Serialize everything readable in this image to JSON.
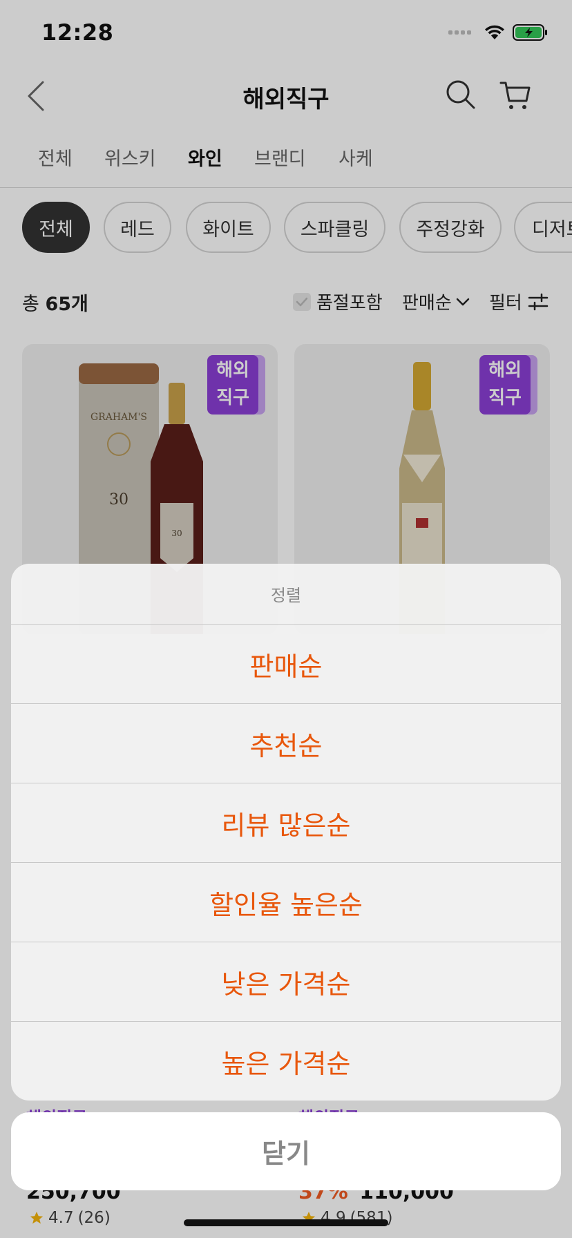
{
  "status_bar": {
    "time": "12:28"
  },
  "header": {
    "title": "해외직구"
  },
  "category_tabs": [
    "전체",
    "위스키",
    "와인",
    "브랜디",
    "사케"
  ],
  "chips": [
    "전체",
    "레드",
    "화이트",
    "스파클링",
    "주정강화",
    "디저트"
  ],
  "count": {
    "prefix": "총",
    "value": "65개"
  },
  "toolbar": {
    "soldout_label": "품절포함",
    "sort_label": "판매순",
    "filter_label": "필터"
  },
  "products": [
    {
      "badge_line1": "해외",
      "badge_line2": "직구",
      "brand": "해외직구",
      "price": "250,700",
      "discount": "",
      "rating": "4.7",
      "reviews": "(26)"
    },
    {
      "badge_line1": "해외",
      "badge_line2": "직구",
      "brand": "해외직구",
      "price": "110,000",
      "discount": "37%",
      "rating": "4.9",
      "reviews": "(581)"
    }
  ],
  "sort_sheet": {
    "title": "정렬",
    "options": [
      "판매순",
      "추천순",
      "리뷰 많은순",
      "할인율 높은순",
      "낮은 가격순",
      "높은 가격순"
    ],
    "close_label": "닫기"
  },
  "colors": {
    "accent": "#e8570c",
    "badge": "#8b3fd6",
    "chip_active": "#333333"
  }
}
